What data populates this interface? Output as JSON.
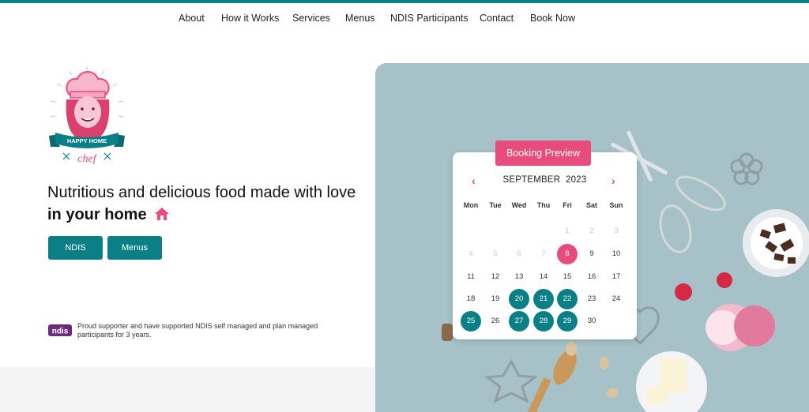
{
  "nav": [
    "About",
    "How it Works",
    "Services",
    "Menus",
    "NDIS Participants",
    "Contact",
    "Book Now"
  ],
  "logo": {
    "banner": "HAPPY HOME",
    "script": "chef"
  },
  "headline": {
    "part1": "Nutritious and delicious food made with love",
    "part2": "in your home"
  },
  "buttons": {
    "ndis": "NDIS",
    "menus": "Menus"
  },
  "ndis": {
    "badge": "ndis",
    "note": "Proud supporter and have supported NDIS self managed and plan managed participants for 3 years."
  },
  "calendar": {
    "pill": "Booking Preview",
    "month": "SEPTEMBER",
    "year": "2023",
    "prev": "‹",
    "next": "›",
    "weekdays": [
      "Mon",
      "Tue",
      "Wed",
      "Thu",
      "Fri",
      "Sat",
      "Sun"
    ],
    "weeks": [
      [
        "",
        "",
        "",
        "",
        "1",
        "2",
        "3"
      ],
      [
        "4",
        "5",
        "6",
        "7",
        "8",
        "9",
        "10"
      ],
      [
        "11",
        "12",
        "13",
        "14",
        "15",
        "16",
        "17"
      ],
      [
        "18",
        "19",
        "20",
        "21",
        "22",
        "23",
        "24"
      ],
      [
        "25",
        "26",
        "27",
        "28",
        "29",
        "30",
        ""
      ]
    ],
    "muted_days": [
      "1",
      "2",
      "3",
      "4",
      "5",
      "6",
      "7"
    ],
    "today": "8",
    "booked_days": [
      "20",
      "21",
      "22",
      "25",
      "27",
      "28",
      "29"
    ]
  },
  "colors": {
    "teal": "#0b7f86",
    "pink": "#e84c7d",
    "hero_bg": "#a6c2c8"
  }
}
